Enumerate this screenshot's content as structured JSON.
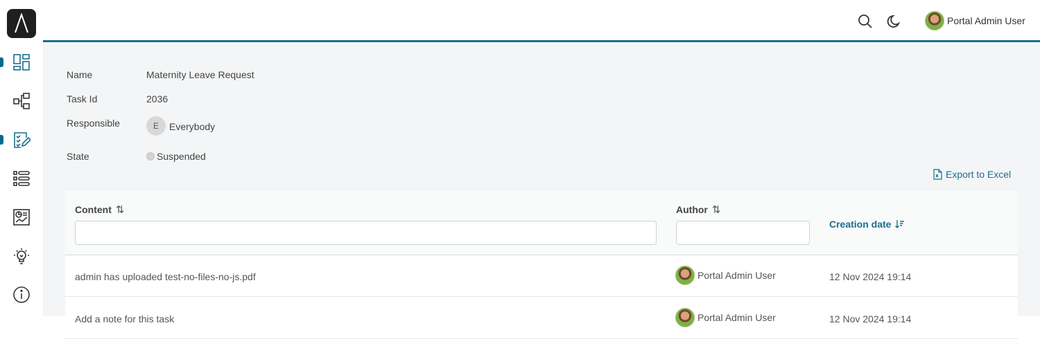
{
  "header": {
    "user_name": "Portal Admin User",
    "search_icon": "search-icon",
    "theme_icon": "moon-icon"
  },
  "sidebar": {
    "items": [
      {
        "name": "dashboard",
        "icon": "dashboard-icon",
        "active": true
      },
      {
        "name": "processes",
        "icon": "process-icon",
        "active": false
      },
      {
        "name": "tasks",
        "icon": "task-icon",
        "active": true
      },
      {
        "name": "cases",
        "icon": "list-icon",
        "active": false
      },
      {
        "name": "statistics",
        "icon": "statistics-icon",
        "active": false
      },
      {
        "name": "ideas",
        "icon": "lightbulb-icon",
        "active": false
      },
      {
        "name": "info",
        "icon": "info-icon",
        "active": false
      }
    ]
  },
  "task": {
    "name_label": "Name",
    "name_value": "Maternity Leave Request",
    "id_label": "Task Id",
    "id_value": "2036",
    "responsible_label": "Responsible",
    "responsible_initial": "E",
    "responsible_value": "Everybody",
    "state_label": "State",
    "state_value": "Suspended"
  },
  "export_label": "Export to Excel",
  "table": {
    "columns": {
      "content": "Content",
      "author": "Author",
      "creation_date": "Creation date"
    },
    "rows": [
      {
        "content": "admin has uploaded test-no-files-no-js.pdf",
        "author": "Portal Admin User",
        "date": "12 Nov 2024 19:14"
      },
      {
        "content": "Add a note for this task",
        "author": "Portal Admin User",
        "date": "12 Nov 2024 19:14"
      }
    ]
  },
  "colors": {
    "accent": "#1a6e8e",
    "background": "#f4f5f6"
  }
}
